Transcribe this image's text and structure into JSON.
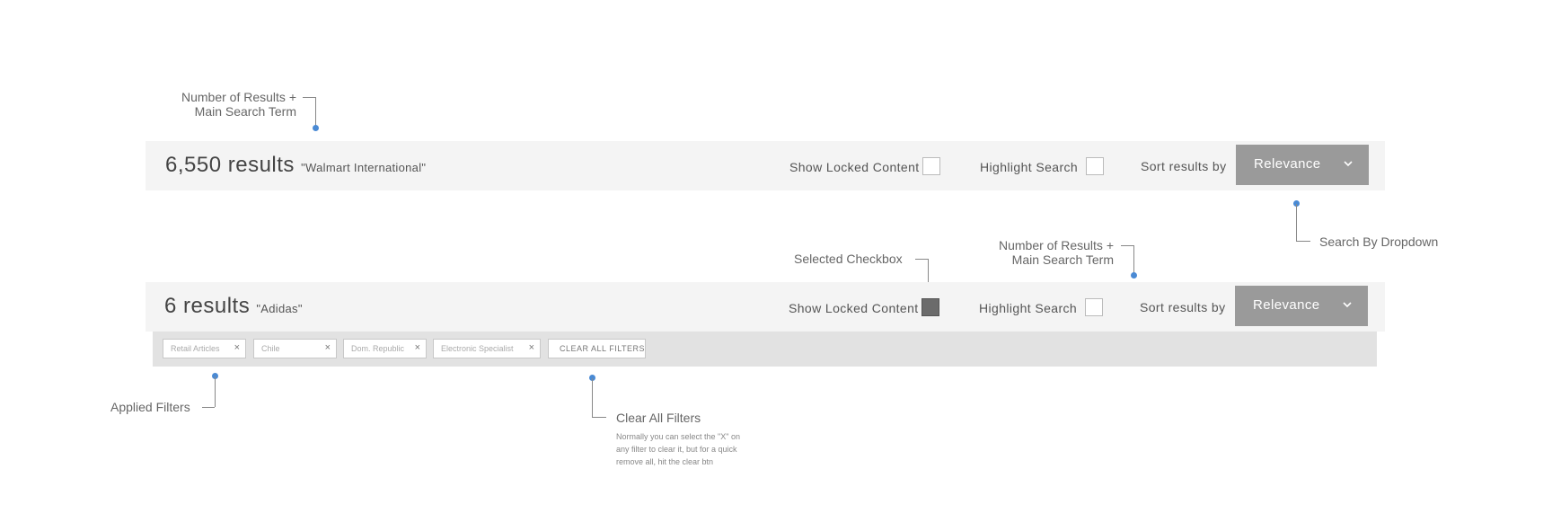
{
  "annotations": {
    "results_top": {
      "line1": "Number of Results +",
      "line2": "Main Search Term"
    },
    "search_by_dropdown": "Search By Dropdown",
    "selected_checkbox": "Selected Checkbox",
    "results_bottom": {
      "line1": "Number of Results +",
      "line2": "Main Search Term"
    },
    "applied_filters": "Applied Filters",
    "clear_all_filters": "Clear All Filters",
    "clear_all_note": "Normally you can select the \"X\" on any filter to clear it, but for a quick remove all, hit the clear btn"
  },
  "bar_top": {
    "count": "6,550 results",
    "term": "\"Walmart International\"",
    "show_locked_label": "Show Locked Content",
    "show_locked_checked": false,
    "highlight_label": "Highlight Search",
    "highlight_checked": false,
    "sort_label": "Sort results by",
    "sort_value": "Relevance"
  },
  "bar_bottom": {
    "count": "6 results",
    "term": "\"Adidas\"",
    "show_locked_label": "Show Locked Content",
    "show_locked_checked": true,
    "highlight_label": "Highlight Search",
    "highlight_checked": false,
    "sort_label": "Sort results by",
    "sort_value": "Relevance"
  },
  "filters": {
    "chips": [
      {
        "label": "Retail Articles",
        "remove": "×"
      },
      {
        "label": "Chile",
        "remove": "×"
      },
      {
        "label": "Dom. Republic",
        "remove": "×"
      },
      {
        "label": "Electronic Specialist",
        "remove": "×"
      }
    ],
    "clear_all": "CLEAR ALL FILTERS"
  },
  "colors": {
    "accent_dot": "#4a8ad4",
    "bar_bg": "#f4f4f4",
    "dropdown_bg": "#9a9a9a",
    "filters_bg": "#e2e2e2",
    "checkbox_checked": "#6b6b6b"
  },
  "icons": {
    "dropdown": "chevron-down-icon",
    "remove_filter": "close-icon"
  }
}
